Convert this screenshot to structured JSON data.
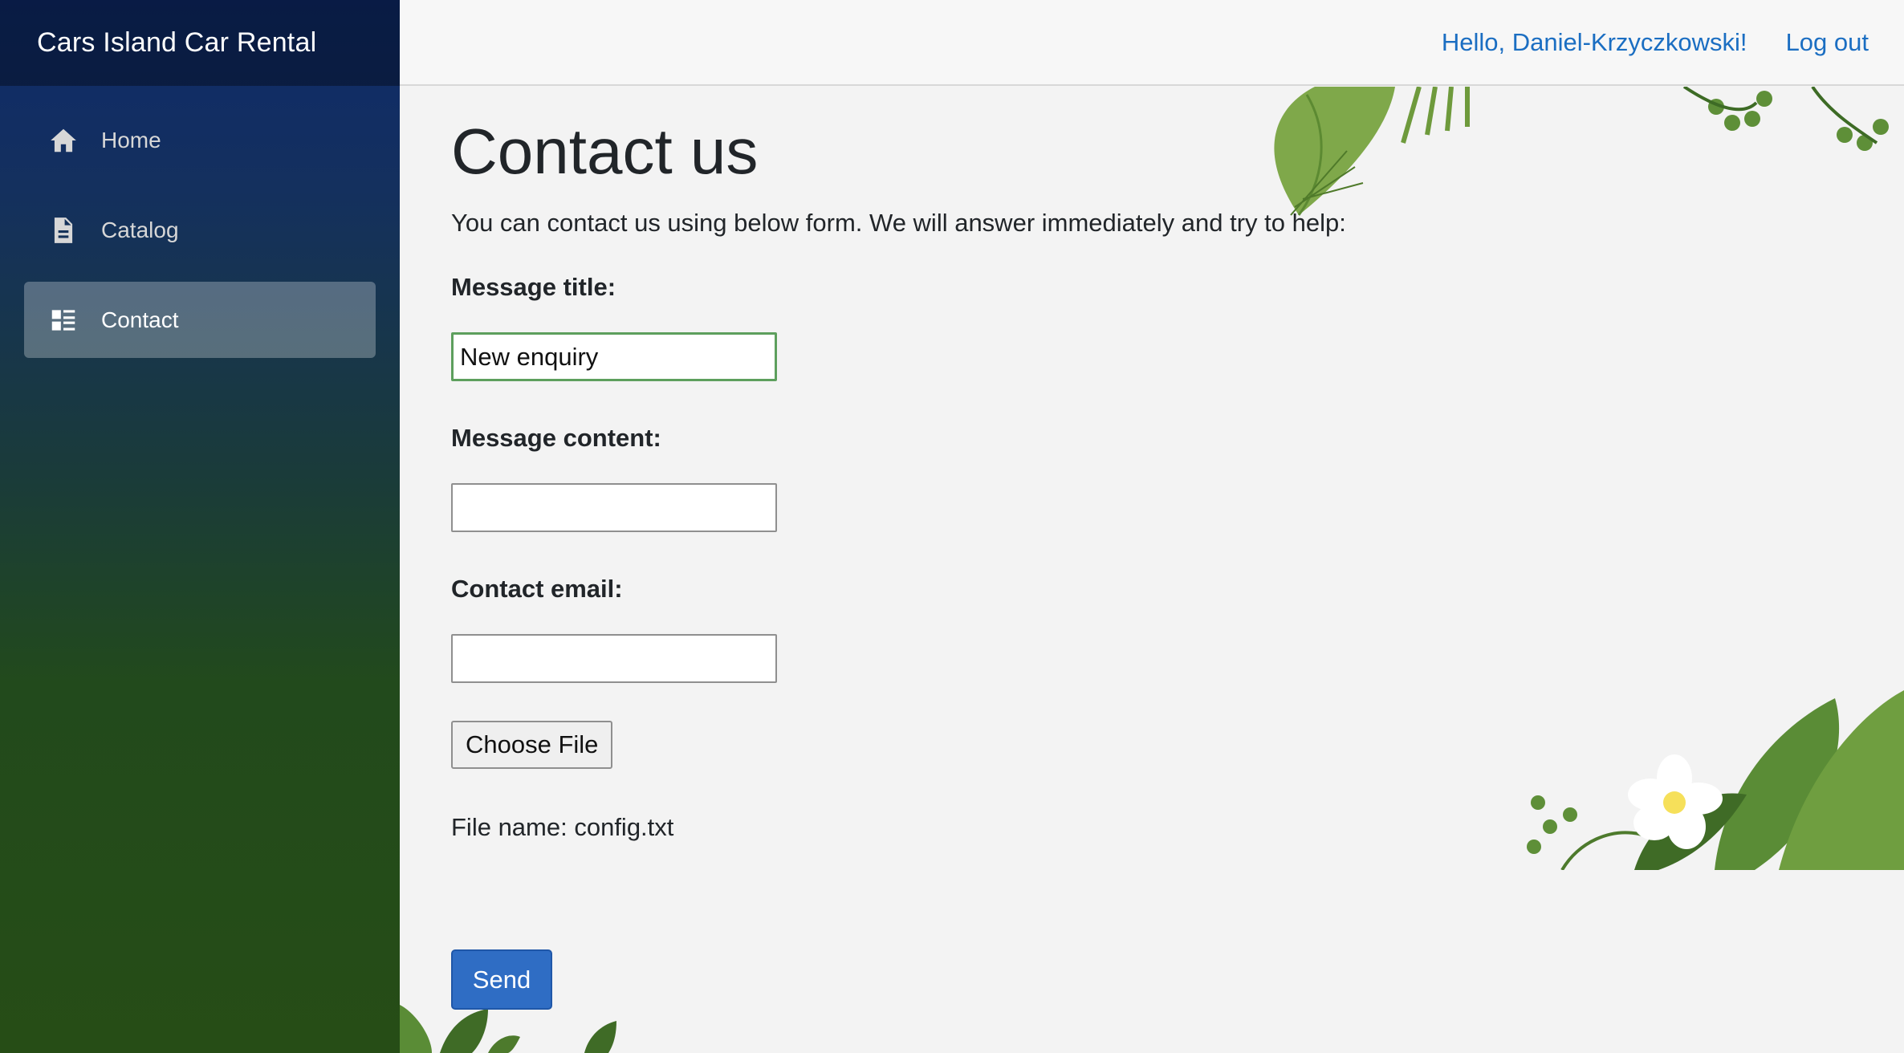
{
  "brand": "Cars Island Car Rental",
  "nav": [
    {
      "label": "Home",
      "icon": "home-icon"
    },
    {
      "label": "Catalog",
      "icon": "document-icon"
    },
    {
      "label": "Contact",
      "icon": "list-icon",
      "active": true
    }
  ],
  "topbar": {
    "greeting": "Hello, Daniel-Krzyczkowski!",
    "logout": "Log out"
  },
  "page": {
    "title": "Contact us",
    "intro": "You can contact us using below form. We will answer immediately and try to help:",
    "title_label": "Message title:",
    "title_value": "New enquiry",
    "content_label": "Message content:",
    "content_value": "",
    "email_label": "Contact email:",
    "email_value": "",
    "choose_file": "Choose File",
    "file_name": "File name: config.txt",
    "send": "Send"
  },
  "colors": {
    "accent": "#1b6ec2",
    "send_button": "#2f6dc4",
    "focus_border": "#5d9f5d"
  }
}
